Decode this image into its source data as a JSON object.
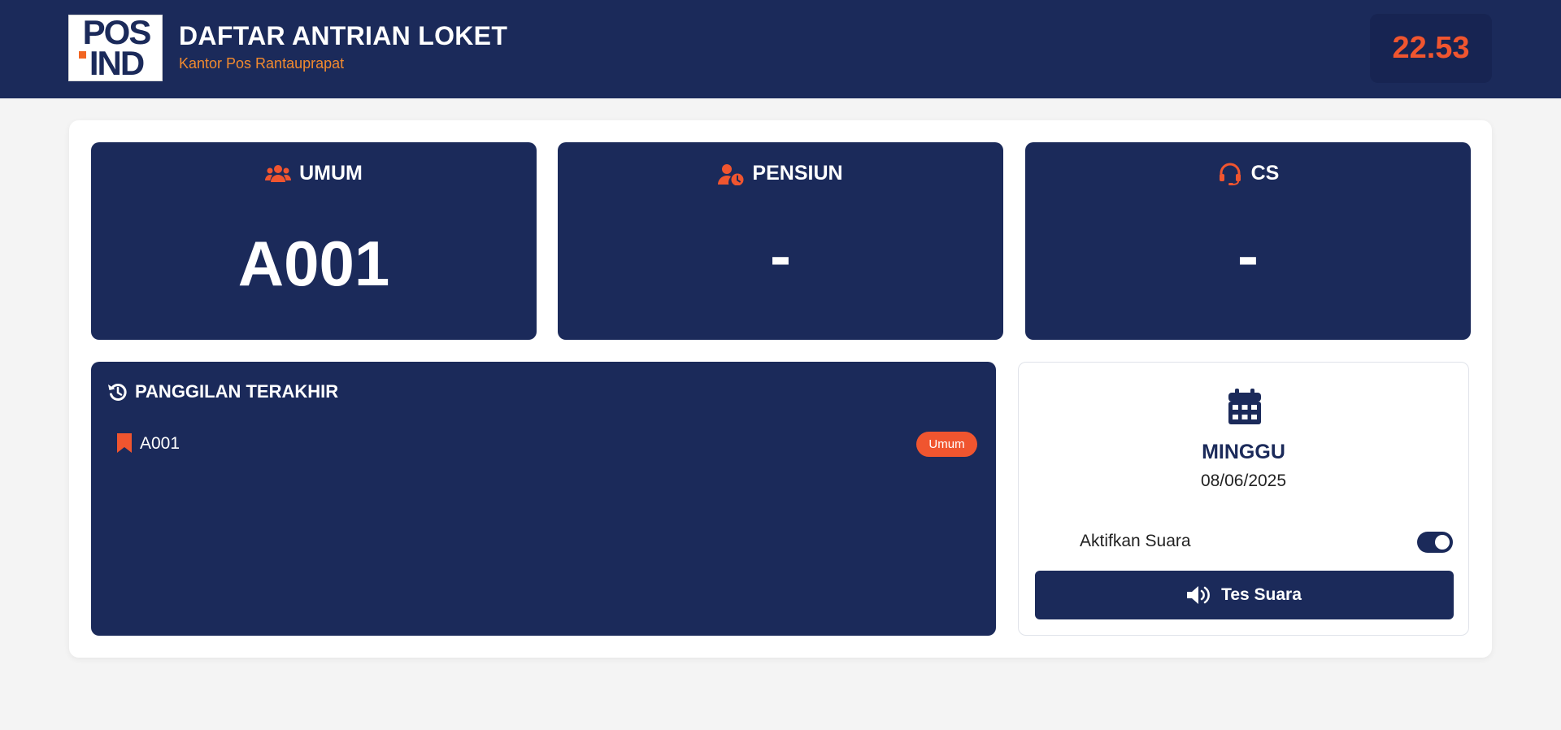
{
  "header": {
    "logo_line1": "POS",
    "logo_line2": "IND",
    "title": "DAFTAR ANTRIAN LOKET",
    "subtitle": "Kantor Pos Rantauprapat",
    "clock": "22.53"
  },
  "counters": [
    {
      "label": "UMUM",
      "icon": "users-icon",
      "number": "A001"
    },
    {
      "label": "PENSIUN",
      "icon": "user-clock-icon",
      "number": "-"
    },
    {
      "label": "CS",
      "icon": "headset-icon",
      "number": "-"
    }
  ],
  "history": {
    "title": "PANGGILAN TERAKHIR",
    "items": [
      {
        "code": "A001",
        "badge": "Umum"
      }
    ]
  },
  "date_card": {
    "day": "MINGGU",
    "date": "08/06/2025",
    "sound_label": "Aktifkan Suara",
    "sound_enabled": true,
    "test_button": "Tes Suara"
  },
  "colors": {
    "navy": "#1b2a5a",
    "accent": "#f0552f",
    "subtitle": "#f28a2e",
    "background": "#f4f4f4"
  }
}
